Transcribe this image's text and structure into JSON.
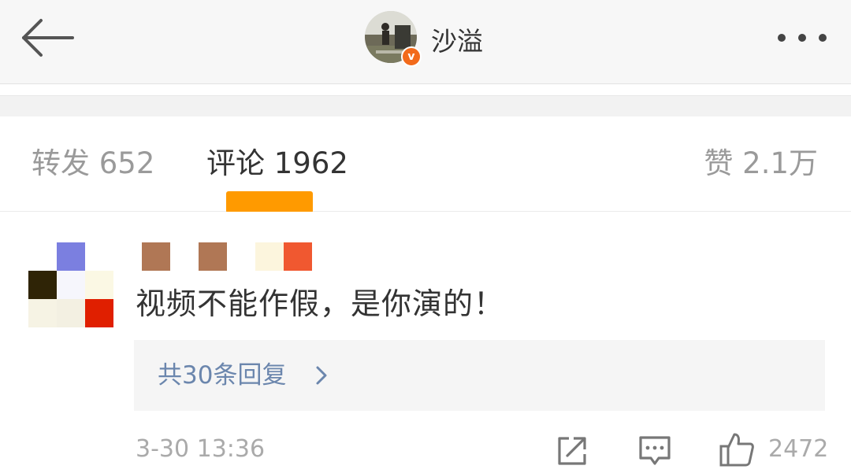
{
  "navbar": {
    "username": "沙溢",
    "badge_letter": "v",
    "icons": {
      "back": "back-arrow-icon",
      "more": "more-dots-icon",
      "verified": "verified-badge-icon"
    }
  },
  "tabs": [
    {
      "label": "转发 652",
      "active": false
    },
    {
      "label": "评论 1962",
      "active": true
    },
    {
      "label": "赞 2.1万",
      "active": false
    }
  ],
  "colors": {
    "accent": "#ff9a00",
    "badge": "#f26a1b",
    "link": "#6b86ad",
    "muted": "#aaaaaa",
    "text": "#333333"
  },
  "comment": {
    "text": "视频不能作假，是你演的！",
    "replies_label": "共30条回复",
    "timestamp": "3-30 13:36",
    "like_count": "2472",
    "icons": {
      "share": "share-external-icon",
      "reply": "comment-bubble-icon",
      "like": "thumbs-up-icon",
      "chevron": "chevron-right-icon"
    },
    "avatar_pixels": [
      "#ffffff",
      "#7b7fe0",
      "#ffffff",
      "#2f2406",
      "#f6f6fc",
      "#fbf8e4",
      "#f6f3e4",
      "#f3f0e2",
      "#e01f00"
    ],
    "username_pixels": [
      "#b07755",
      "#b07755",
      "#fcf5dd",
      "#f05830"
    ]
  }
}
